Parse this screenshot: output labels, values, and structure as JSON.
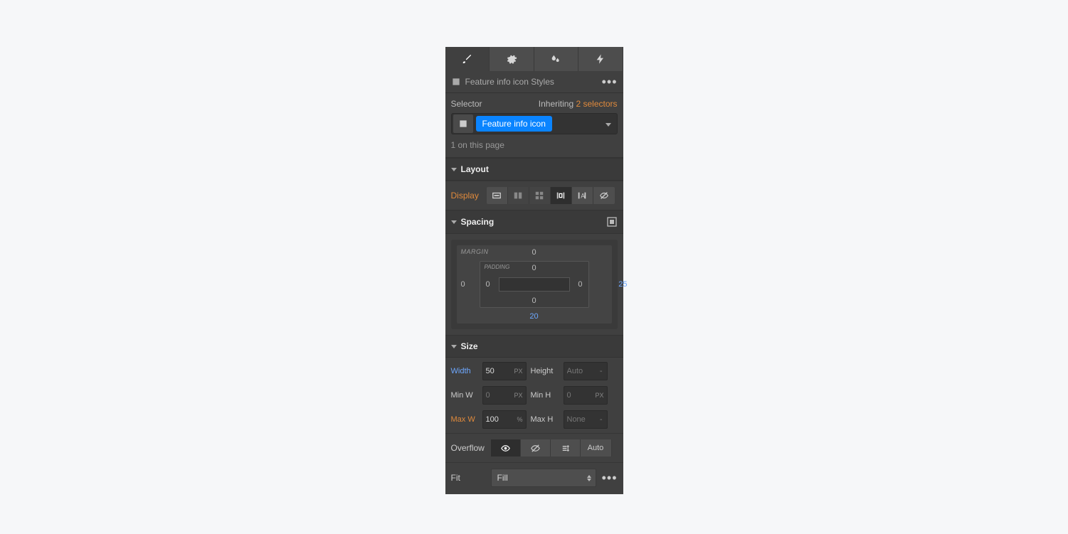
{
  "header": {
    "title": "Feature info icon Styles"
  },
  "selector": {
    "label": "Selector",
    "inheriting_prefix": "Inheriting ",
    "inheriting_link": "2 selectors",
    "chip": "Feature info icon",
    "count": "1 on this page"
  },
  "sections": {
    "layout": {
      "title": "Layout",
      "display_label": "Display"
    },
    "spacing": {
      "title": "Spacing",
      "margin_label": "MARGIN",
      "padding_label": "PADDING",
      "margin": {
        "top": "0",
        "right": "25",
        "bottom": "20",
        "left": "0"
      },
      "padding": {
        "top": "0",
        "right": "0",
        "bottom": "0",
        "left": "0"
      }
    },
    "size": {
      "title": "Size",
      "width_label": "Width",
      "width_value": "50",
      "width_unit": "PX",
      "height_label": "Height",
      "height_placeholder": "Auto",
      "minw_label": "Min W",
      "minw_placeholder": "0",
      "minw_unit": "PX",
      "minh_label": "Min H",
      "minh_placeholder": "0",
      "minh_unit": "PX",
      "maxw_label": "Max W",
      "maxw_value": "100",
      "maxw_unit": "%",
      "maxh_label": "Max H",
      "maxh_placeholder": "None",
      "overflow_label": "Overflow",
      "overflow_auto": "Auto",
      "fit_label": "Fit",
      "fit_value": "Fill"
    }
  }
}
